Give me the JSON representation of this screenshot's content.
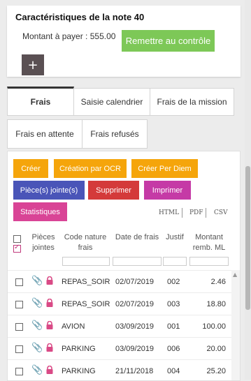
{
  "note": {
    "title": "Caractéristiques de la note 40",
    "amount_label": "Montant à payer : 555.00",
    "control_button": "Remettre au contrôle",
    "add_button": "+"
  },
  "tabs": [
    {
      "label": "Frais",
      "active": true
    },
    {
      "label": "Saisie calendrier",
      "active": false
    },
    {
      "label": "Frais de la mission",
      "active": false
    },
    {
      "label": "Frais en attente",
      "active": false
    },
    {
      "label": "Frais refusés",
      "active": false
    }
  ],
  "actions": {
    "create": "Créer",
    "create_ocr": "Création par OCR",
    "create_per_diem": "Créer Per Diem",
    "attachments": "Pièce(s) jointe(s)",
    "delete": "Supprimer",
    "print": "Imprimer",
    "stats": "Statistiques"
  },
  "export": {
    "html": "HTML",
    "pdf": "PDF",
    "csv": "CSV"
  },
  "table": {
    "headers": {
      "attachments": "Pièces jointes",
      "code": "Code nature frais",
      "date": "Date de frais",
      "justif": "Justif",
      "amount": "Montant remb. ML"
    },
    "rows": [
      {
        "code": "REPAS_SOIR",
        "date": "02/07/2019",
        "justif": "002",
        "amount": "2.46"
      },
      {
        "code": "REPAS_SOIR",
        "date": "02/07/2019",
        "justif": "003",
        "amount": "18.80"
      },
      {
        "code": "AVION",
        "date": "03/09/2019",
        "justif": "001",
        "amount": "100.00"
      },
      {
        "code": "PARKING",
        "date": "03/09/2019",
        "justif": "006",
        "amount": "20.00"
      },
      {
        "code": "PARKING",
        "date": "21/11/2018",
        "justif": "004",
        "amount": "25.20"
      }
    ]
  },
  "colors": {
    "green": "#7dc857",
    "orange": "#f5a50b",
    "blue": "#4a55b8",
    "red": "#d43a3a",
    "magenta": "#c53aa6",
    "pink": "#d94496",
    "icon_pink": "#d94a86"
  }
}
